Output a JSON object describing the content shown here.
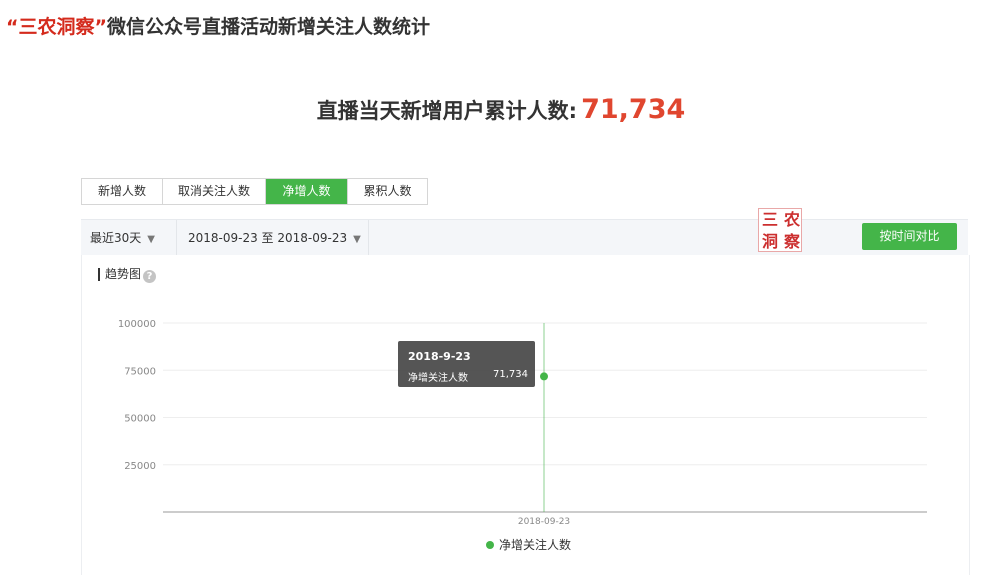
{
  "header": {
    "brand": "“三农洞察”",
    "title_rest": "微信公众号直播活动新增关注人数统计"
  },
  "summary": {
    "label": "直播当天新增用户累计人数:",
    "value": "71,734"
  },
  "tabs": [
    {
      "label": "新增人数",
      "active": false
    },
    {
      "label": "取消关注人数",
      "active": false
    },
    {
      "label": "净增人数",
      "active": true
    },
    {
      "label": "累积人数",
      "active": false
    }
  ],
  "filters": {
    "period": "最近30天",
    "date_range": "2018-09-23 至 2018-09-23"
  },
  "seal": {
    "chars": [
      "三",
      "农",
      "洞",
      "察"
    ]
  },
  "compare_button": "按时间对比",
  "chart_section": {
    "title": "趋势图",
    "help": "?"
  },
  "tooltip": {
    "date": "2018-9-23",
    "series": "净增关注人数",
    "value": "71,734"
  },
  "colors": {
    "accent": "#44b549",
    "brand_red": "#d42a1c",
    "value_red": "#e0462f"
  },
  "chart_data": {
    "type": "line",
    "x": [
      "2018-09-23"
    ],
    "series": [
      {
        "name": "净增关注人数",
        "values": [
          71734
        ],
        "color": "#44b549"
      }
    ],
    "ylim": [
      0,
      100000
    ],
    "yticks": [
      25000,
      50000,
      75000,
      100000
    ],
    "ytick_labels": [
      "25000",
      "50000",
      "75000",
      "100000"
    ],
    "xtick_labels": [
      "2018-09-23"
    ],
    "grid": true,
    "legend": "bottom-center"
  }
}
